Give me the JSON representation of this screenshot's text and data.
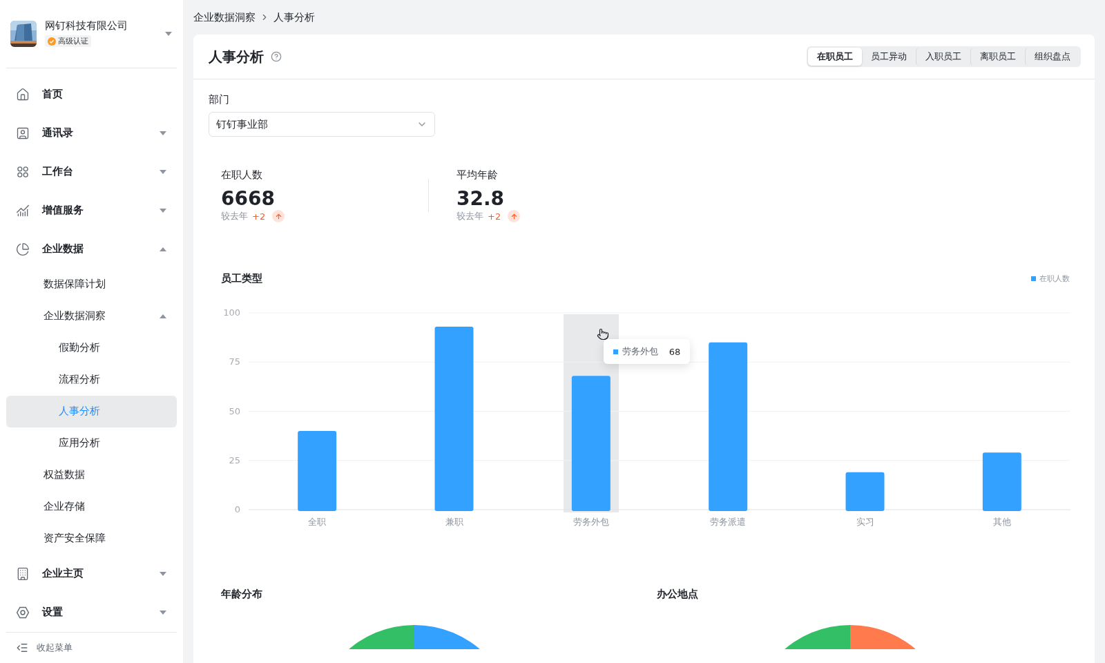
{
  "company": {
    "name": "网钉科技有限公司",
    "badge": "高级认证"
  },
  "sidebar": {
    "items": [
      {
        "label": "首页",
        "selected": false
      },
      {
        "label": "通讯录",
        "selected": false,
        "expanded": false
      },
      {
        "label": "工作台",
        "selected": false,
        "expanded": false
      },
      {
        "label": "增值服务",
        "selected": false,
        "expanded": false
      },
      {
        "label": "企业数据",
        "selected": false,
        "expanded": true,
        "children": [
          {
            "label": "数据保障计划",
            "selected": false
          },
          {
            "label": "企业数据洞察",
            "selected": false,
            "expanded": true,
            "children": [
              {
                "label": "假勤分析",
                "selected": false
              },
              {
                "label": "流程分析",
                "selected": false
              },
              {
                "label": "人事分析",
                "selected": true
              },
              {
                "label": "应用分析",
                "selected": false
              }
            ]
          },
          {
            "label": "权益数据",
            "selected": false
          },
          {
            "label": "企业存储",
            "selected": false
          },
          {
            "label": "资产安全保障",
            "selected": false
          }
        ]
      },
      {
        "label": "企业主页",
        "selected": false,
        "expanded": false
      },
      {
        "label": "设置",
        "selected": false,
        "expanded": false
      }
    ],
    "collapse": "收起菜单"
  },
  "breadcrumb": [
    "企业数据洞察",
    "人事分析"
  ],
  "page": {
    "title": "人事分析",
    "tabs": [
      {
        "label": "在职员工",
        "selected": true
      },
      {
        "label": "员工异动",
        "selected": false
      },
      {
        "label": "入职员工",
        "selected": false
      },
      {
        "label": "离职员工",
        "selected": false
      },
      {
        "label": "组织盘点",
        "selected": false
      }
    ],
    "department": {
      "label": "部门",
      "value": "钉钉事业部"
    },
    "stats": [
      {
        "label": "在职人数",
        "value": "6668",
        "compare": "较去年",
        "delta": "+2"
      },
      {
        "label": "平均年龄",
        "value": "32.8",
        "compare": "较去年",
        "delta": "+2"
      }
    ],
    "employee_type": {
      "title": "员工类型",
      "hovered": [
        false,
        false,
        true,
        false,
        false,
        false
      ],
      "tooltip": {
        "label": "劳务外包",
        "value": "68"
      },
      "chart_data": {
        "type": "bar",
        "categories": [
          "全职",
          "兼职",
          "劳务外包",
          "劳务派遣",
          "实习",
          "其他"
        ],
        "series": [
          {
            "name": "在职人数",
            "color": "#33a1ff",
            "values": [
              40,
              93,
              68,
              85,
              19,
              29
            ]
          }
        ],
        "ylim": [
          0,
          100
        ],
        "yticks": [
          0,
          25,
          50,
          75,
          100
        ],
        "grid": true
      }
    },
    "age": {
      "title": "年龄分布"
    },
    "office": {
      "title": "办公地点"
    }
  }
}
